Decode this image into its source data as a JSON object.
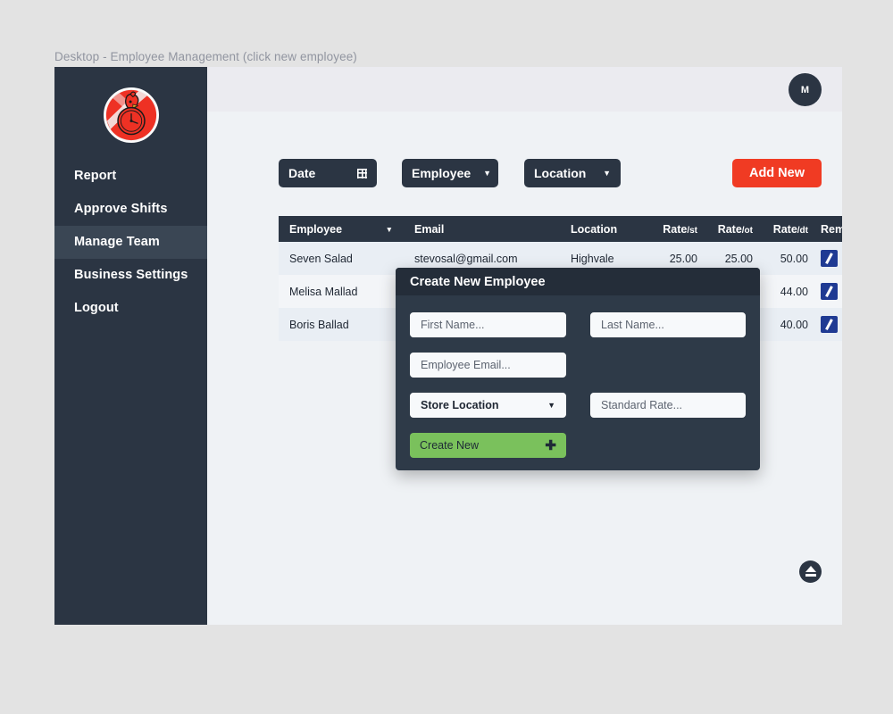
{
  "window": {
    "title": "Desktop - Employee Management (click new employee)"
  },
  "sidebar": {
    "logo_name": "rooster-clock-logo",
    "items": [
      {
        "label": "Report",
        "active": false
      },
      {
        "label": "Approve Shifts",
        "active": false
      },
      {
        "label": "Manage Team",
        "active": true
      },
      {
        "label": "Business Settings",
        "active": false
      },
      {
        "label": "Logout",
        "active": false
      }
    ]
  },
  "topbar": {
    "avatar_initial": "M"
  },
  "toolbar": {
    "date_label": "Date",
    "date_icon": "calendar-grid-icon",
    "employee_label": "Employee",
    "location_label": "Location",
    "caret": "▼",
    "add_new_label": "Add New"
  },
  "table": {
    "columns": {
      "employee": "Employee",
      "email": "Email",
      "location": "Location",
      "rate_st_main": "Rate",
      "rate_st_sub": "/st",
      "rate_ot_main": "Rate",
      "rate_ot_sub": "/ot",
      "rate_dt_main": "Rate",
      "rate_dt_sub": "/dt",
      "remove": "Remove"
    },
    "sort_indicator": "▼",
    "rows": [
      {
        "employee": "Seven Salad",
        "email": "stevosal@gmail.com",
        "location": "Highvale",
        "rate_st": "25.00",
        "rate_ot": "25.00",
        "rate_dt": "50.00"
      },
      {
        "employee": "Melisa Mallad",
        "email": "",
        "location": "",
        "rate_st": "",
        "rate_ot": "",
        "rate_dt": "44.00"
      },
      {
        "employee": "Boris Ballad",
        "email": "",
        "location": "",
        "rate_st": "",
        "rate_ot": "",
        "rate_dt": "40.00"
      }
    ],
    "delete_glyph": "✕"
  },
  "modal": {
    "title": "Create New Employee",
    "first_name_placeholder": "First Name...",
    "last_name_placeholder": "Last Name...",
    "email_placeholder": "Employee Email...",
    "store_location_value": "Store Location",
    "store_location_caret": "▼",
    "standard_rate_placeholder": "Standard Rate...",
    "create_label": "Create New",
    "create_plus": "✚"
  },
  "fab": {
    "name": "eject-icon"
  },
  "colors": {
    "sidebar": "#2b3543",
    "sidebar_active": "#3a4654",
    "accent_red": "#f03b23",
    "accent_green": "#7ac15c",
    "edit_blue": "#1f3a93",
    "delete_red": "#ee1c1c",
    "page_bg": "#e3e3e3",
    "content_bg": "#eff2f5"
  }
}
